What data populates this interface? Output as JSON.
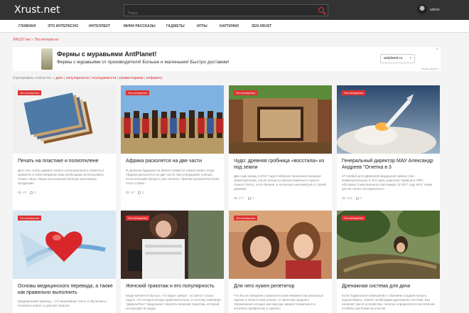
{
  "header": {
    "logo": "Xrust.net",
    "search_placeholder": "Поиск",
    "username": "admin"
  },
  "nav": {
    "items": [
      "ГЛАВНАЯ",
      "ЭТО ИНТЕРЕСНО",
      "ИНТЕЛЛЕКТ",
      "МИНИ РАССКАЗЫ",
      "ГАДЖЕТЫ",
      "ИГРЫ",
      "КАРТИНКИ",
      "ZEN XRUST"
    ]
  },
  "breadcrumb": {
    "home": "XRUST.net",
    "sep": "»",
    "current": "Это интересно"
  },
  "ad": {
    "label": "Реклама",
    "title": "Фермы с муравьями AntPlanet!",
    "text": "Фермы с муравьями от производителя! Больше и маленькие! Быстро доставим!",
    "button": "antplanet.ru",
    "button_arrow": "›",
    "close": "×",
    "source": "Яндекс.Директ"
  },
  "sort": {
    "label": "Сортировать статьи по:",
    "options": [
      "дате",
      "популярности",
      "посещаемости",
      "комментариям",
      "алфавиту"
    ]
  },
  "tag_label": "Это интересно",
  "cards": [
    {
      "title": "Печать на пластике и полиэтилене",
      "desc": "Для того чтобы удивить своего потенциального клиента и привлечь в себе внимание вам необходимо использовать только лишь самую высококачественную рекламную продукцию.",
      "views": "40",
      "likes": "0",
      "image": "printing"
    },
    {
      "title": "Африка расколется на две части",
      "desc": "В далеком будущем на Земле появится новый океан, когда Африка расколется на две части. Как утверждают ученые, геологический процесс уже начался. Причем доказательством этого служит...",
      "views": "50",
      "likes": "0",
      "image": "africa"
    },
    {
      "title": "Чудо: древняя гробница «восстала» из под земли",
      "desc": "Два года назад, в 2017 году в Мексике произошло мощное землетрясение, после которого начали каменного пункта Синего Тепло, атол Океана, и несколько километров от своей деревни",
      "views": "277",
      "likes": "0",
      "image": "tomb"
    },
    {
      "title": "Генеральный директор МАУ Александр Андреев \"Огнетка в 3",
      "desc": "27 ноября для уфимской воздушной гавани стал знаменательным, в этот день аэропорт первым в ПФО обслужил 3 миллионного пассажира. В 2017 году МАУ также достиг своего исторического",
      "views": "245",
      "likes": "0",
      "image": "rocket"
    },
    {
      "title": "Основы медицинского перевода, а также как правильно выполнить",
      "desc": "Медицинский перевод – это важнейшая часть в обучении и познании нового и данной отрасли.",
      "views": "",
      "likes": "",
      "image": "heart"
    },
    {
      "title": "Женский трикотаж и его популярность",
      "desc": "Мода меняется быстро, что будет завтра - остается только гадать. Но сегодня всегда привлекательна, и поэтому компания \"ДжерсиТекс\" предлагает покупать женский трикотаж, который не выходит из моды",
      "views": "",
      "likes": "",
      "image": "knit"
    },
    {
      "title": "Для чего нужен репетитор",
      "desc": "Что бы не говорили о важности (или неважности) школьных оценок в личностном успехе, от качества среднего образования сегодня как никогда зависит возможность получить профессию и сделать",
      "views": "",
      "likes": "",
      "image": "tutor"
    },
    {
      "title": "Дренажная система для дачи",
      "desc": "Если подвальное помещение с обилием осадков начало подтапливать, значит необходима дренажная система. Без наличия такого устройства, типично определяется затопление и гибель растений на участке",
      "views": "",
      "likes": "",
      "image": "drain"
    }
  ],
  "colors": {
    "accent": "#dd3333",
    "topbar": "#333333"
  }
}
